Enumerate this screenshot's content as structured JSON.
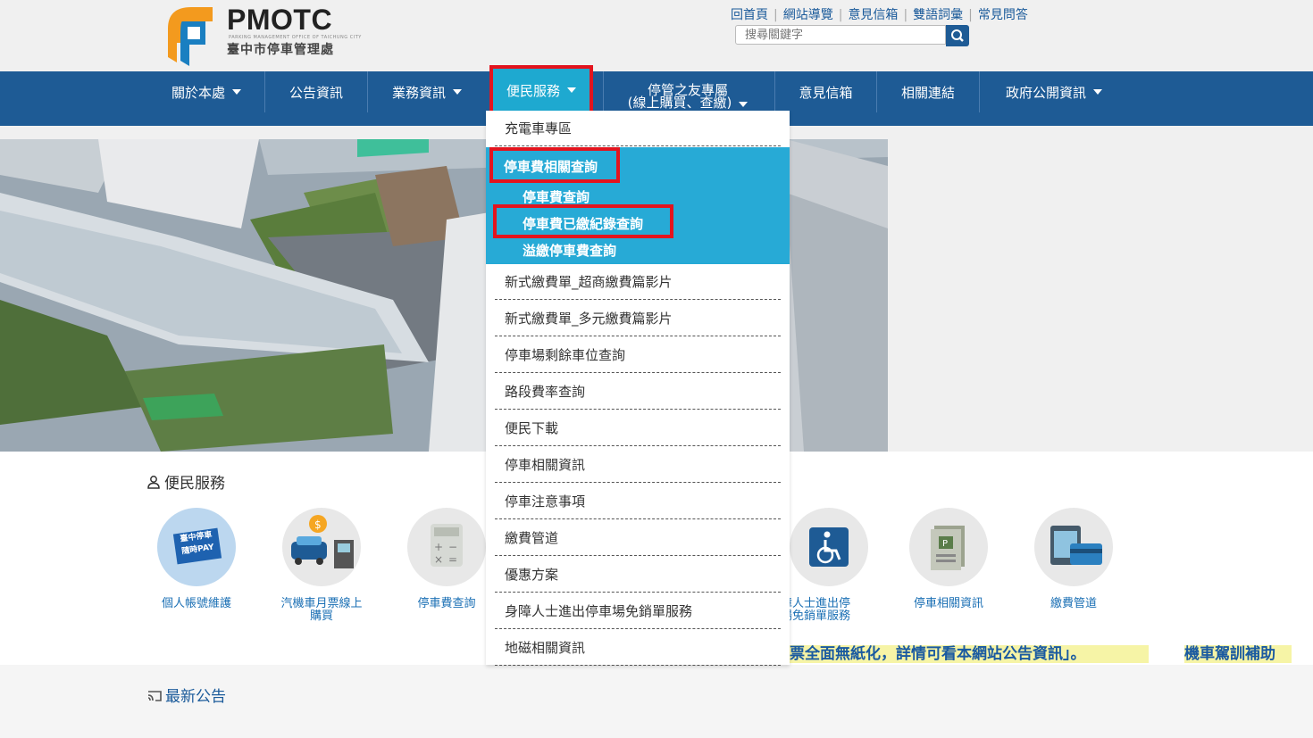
{
  "logo": {
    "title": "PMOTC",
    "subtitle": "PARKING MANAGEMENT OFFICE OF TAICHUNG CITY",
    "chinese": "臺中市停車管理處"
  },
  "top_links": [
    "回首頁",
    "網站導覽",
    "意見信箱",
    "雙語詞彙",
    "常見問答"
  ],
  "search": {
    "placeholder": "搜尋關鍵字"
  },
  "nav": {
    "items": [
      "關於本處",
      "公告資訊",
      "業務資訊",
      "便民服務",
      "意見信箱",
      "相關連結",
      "政府公開資訊"
    ],
    "multi_line_1": "停管之友專屬",
    "multi_line_2": "(線上購買、查繳)"
  },
  "dropdown": {
    "first": "充電車專區",
    "group_title": "停車費相關查詢",
    "group_items": [
      "停車費查詢",
      "停車費已繳紀錄查詢",
      "溢繳停車費查詢"
    ],
    "items": [
      "新式繳費單_超商繳費篇影片",
      "新式繳費單_多元繳費篇影片",
      "停車場剩餘車位查詢",
      "路段費率查詢",
      "便民下載",
      "停車相關資訊",
      "停車注意事項",
      "繳費管道",
      "優惠方案",
      "身障人士進出停車場免銷單服務",
      "地磁相關資訊"
    ]
  },
  "services": {
    "title": "便民服務",
    "items": [
      {
        "label": "個人帳號維護"
      },
      {
        "label1": "汽機車月票線上",
        "label2": "購買"
      },
      {
        "label": "停車費查詢"
      },
      {
        "label1": "障人士進出停",
        "label2": "場免銷單服務"
      },
      {
        "label": "停車相關資訊"
      },
      {
        "label": "繳費管道"
      }
    ],
    "badge1": "臺中停車",
    "badge2": "隨時PAY"
  },
  "marquee": {
    "text1": "票全面無紙化，詳情可看本網站公告資訊」。",
    "text2": "機車駕訓補助"
  },
  "news": {
    "title": "最新公告"
  },
  "colors": {
    "nav_bg": "#1e5b95",
    "accent": "#27aad6",
    "highlight": "#e3141e"
  }
}
